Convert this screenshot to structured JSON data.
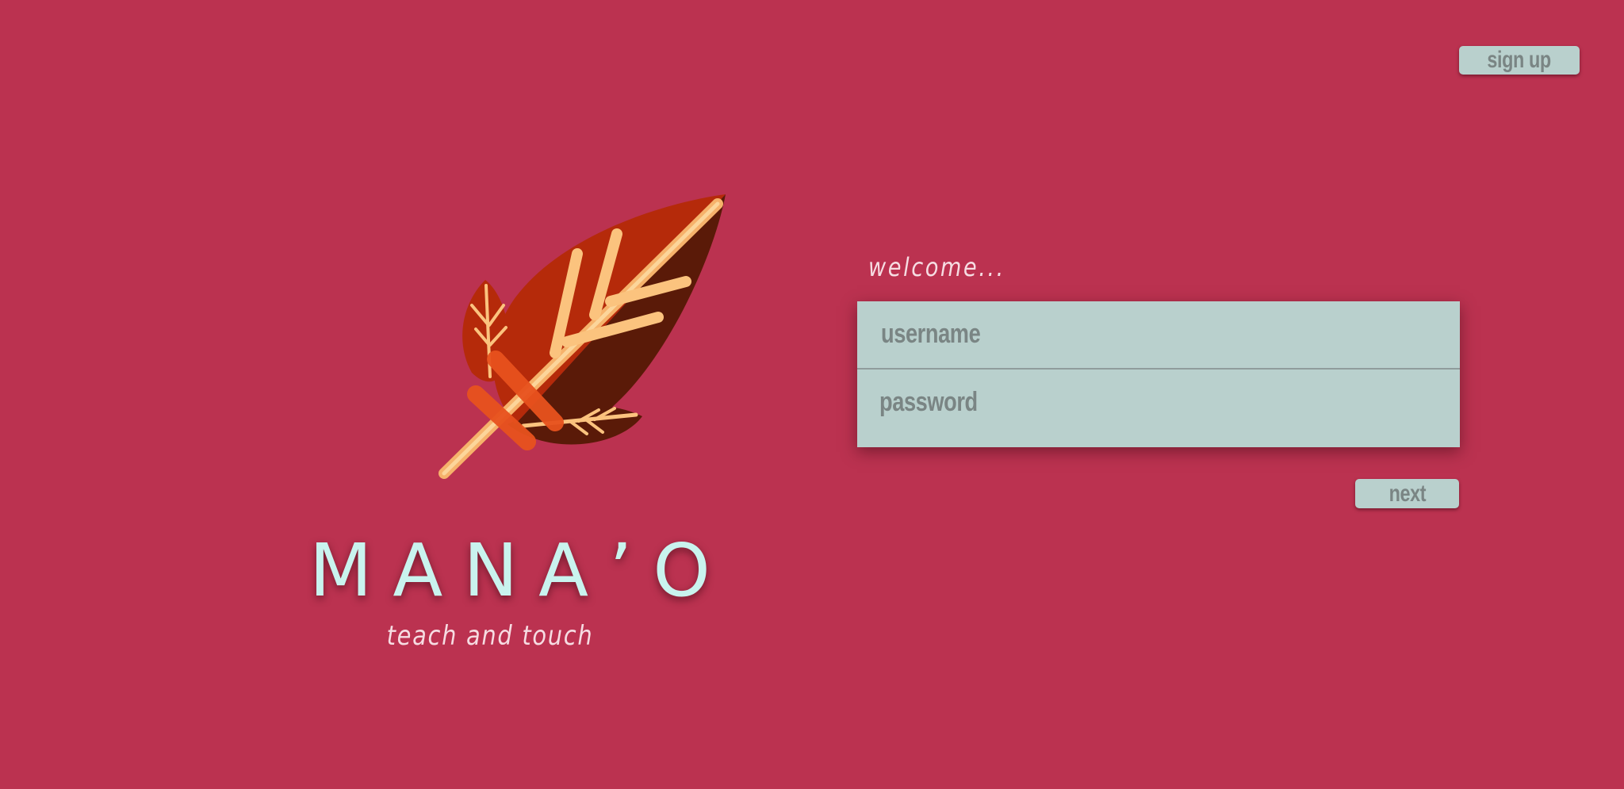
{
  "header": {
    "signup_label": "sign up"
  },
  "brand": {
    "name": "MANA’O",
    "tagline": "teach and touch",
    "logo_icon": "feather-leaf-icon"
  },
  "login": {
    "welcome": "welcome...",
    "username_placeholder": "username",
    "password_placeholder": "password",
    "next_label": "next"
  },
  "colors": {
    "background": "#bb3250",
    "panel": "#b9d0cd",
    "panel_text": "#7a8584",
    "brand_text": "#c9f3ee",
    "welcome_text": "#f6dce2"
  }
}
